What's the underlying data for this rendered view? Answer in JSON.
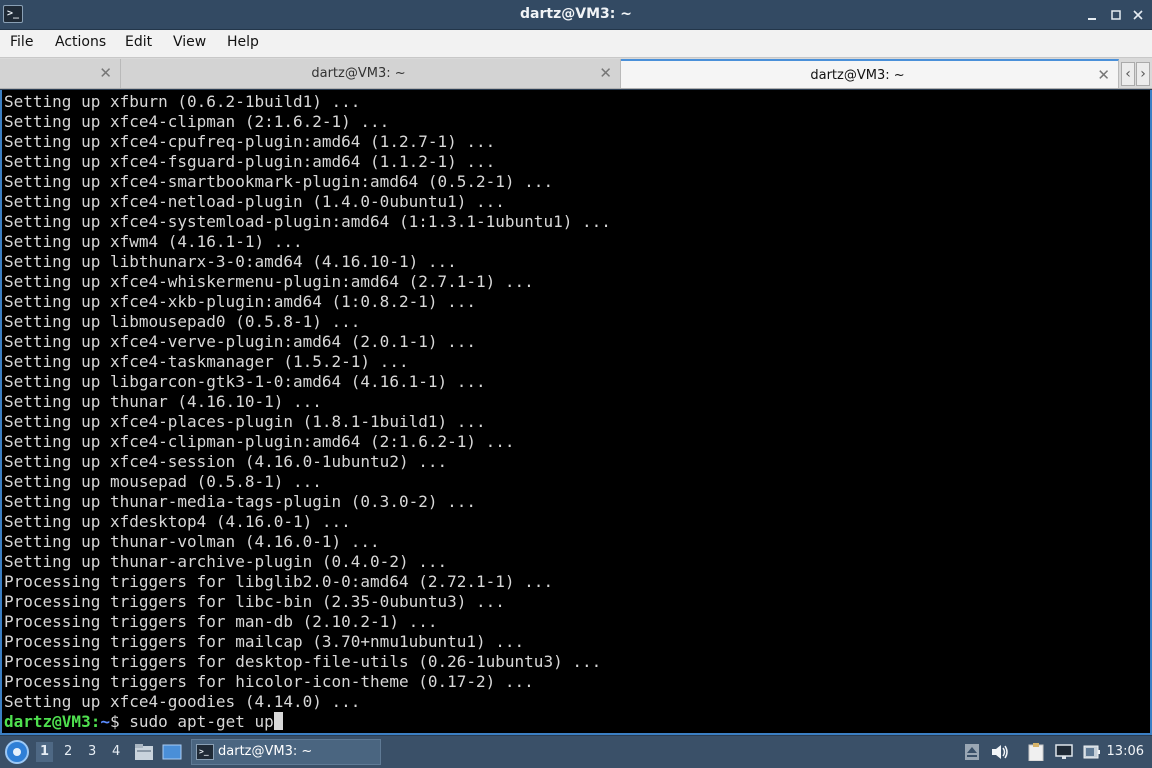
{
  "window": {
    "title": "dartz@VM3: ~",
    "app_icon_glyph": ">_"
  },
  "menu": [
    "File",
    "Actions",
    "Edit",
    "View",
    "Help"
  ],
  "tabs": [
    {
      "label": "",
      "active": false
    },
    {
      "label": "dartz@VM3: ~",
      "active": false
    },
    {
      "label": "dartz@VM3: ~",
      "active": true
    }
  ],
  "tab_close_glyph": "✕",
  "tab_nav": {
    "left": "‹",
    "right": "›"
  },
  "terminal": {
    "lines": [
      "Setting up xfburn (0.6.2-1build1) ...",
      "Setting up xfce4-clipman (2:1.6.2-1) ...",
      "Setting up xfce4-cpufreq-plugin:amd64 (1.2.7-1) ...",
      "Setting up xfce4-fsguard-plugin:amd64 (1.1.2-1) ...",
      "Setting up xfce4-smartbookmark-plugin:amd64 (0.5.2-1) ...",
      "Setting up xfce4-netload-plugin (1.4.0-0ubuntu1) ...",
      "Setting up xfce4-systemload-plugin:amd64 (1:1.3.1-1ubuntu1) ...",
      "Setting up xfwm4 (4.16.1-1) ...",
      "Setting up libthunarx-3-0:amd64 (4.16.10-1) ...",
      "Setting up xfce4-whiskermenu-plugin:amd64 (2.7.1-1) ...",
      "Setting up xfce4-xkb-plugin:amd64 (1:0.8.2-1) ...",
      "Setting up libmousepad0 (0.5.8-1) ...",
      "Setting up xfce4-verve-plugin:amd64 (2.0.1-1) ...",
      "Setting up xfce4-taskmanager (1.5.2-1) ...",
      "Setting up libgarcon-gtk3-1-0:amd64 (4.16.1-1) ...",
      "Setting up thunar (4.16.10-1) ...",
      "Setting up xfce4-places-plugin (1.8.1-1build1) ...",
      "Setting up xfce4-clipman-plugin:amd64 (2:1.6.2-1) ...",
      "Setting up xfce4-session (4.16.0-1ubuntu2) ...",
      "Setting up mousepad (0.5.8-1) ...",
      "Setting up thunar-media-tags-plugin (0.3.0-2) ...",
      "Setting up xfdesktop4 (4.16.0-1) ...",
      "Setting up thunar-volman (4.16.0-1) ...",
      "Setting up thunar-archive-plugin (0.4.0-2) ...",
      "Processing triggers for libglib2.0-0:amd64 (2.72.1-1) ...",
      "Processing triggers for libc-bin (2.35-0ubuntu3) ...",
      "Processing triggers for man-db (2.10.2-1) ...",
      "Processing triggers for mailcap (3.70+nmu1ubuntu1) ...",
      "Processing triggers for desktop-file-utils (0.26-1ubuntu3) ...",
      "Processing triggers for hicolor-icon-theme (0.17-2) ...",
      "Setting up xfce4-goodies (4.14.0) ..."
    ],
    "prompt": {
      "user_host": "dartz@VM3",
      "sep": ":",
      "path": "~",
      "symbol": "$ ",
      "command": "sudo apt-get up"
    }
  },
  "taskbar": {
    "workspaces": [
      "1",
      "2",
      "3",
      "4"
    ],
    "active_workspace": "1",
    "task_label": "dartz@VM3: ~",
    "clock": "13:06"
  },
  "colors": {
    "prompt_user": "#4fe04f",
    "prompt_path": "#5b8cff",
    "terminal_bg": "#000000",
    "terminal_fg": "#d8d8d8",
    "tab_accent": "#4a90d9"
  }
}
